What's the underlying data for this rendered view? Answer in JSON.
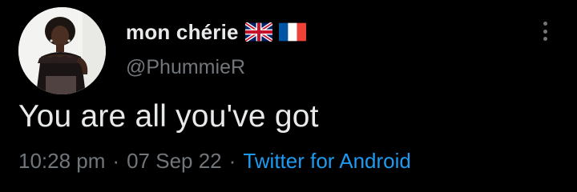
{
  "tweet": {
    "author": {
      "display_name": "mon chérie",
      "flags": [
        "uk-flag-icon",
        "france-flag-icon"
      ],
      "handle": "@PhummieR"
    },
    "text": "You are all you've got",
    "meta": {
      "time": "10:28 pm",
      "separator": "·",
      "date": "07 Sep 22",
      "source": "Twitter for Android"
    },
    "more_menu_icon": "vertical-ellipsis-icon"
  },
  "colors": {
    "background": "#000000",
    "primary_text": "#e7e9ea",
    "secondary_text": "#71767b",
    "link": "#1d9bf0"
  }
}
